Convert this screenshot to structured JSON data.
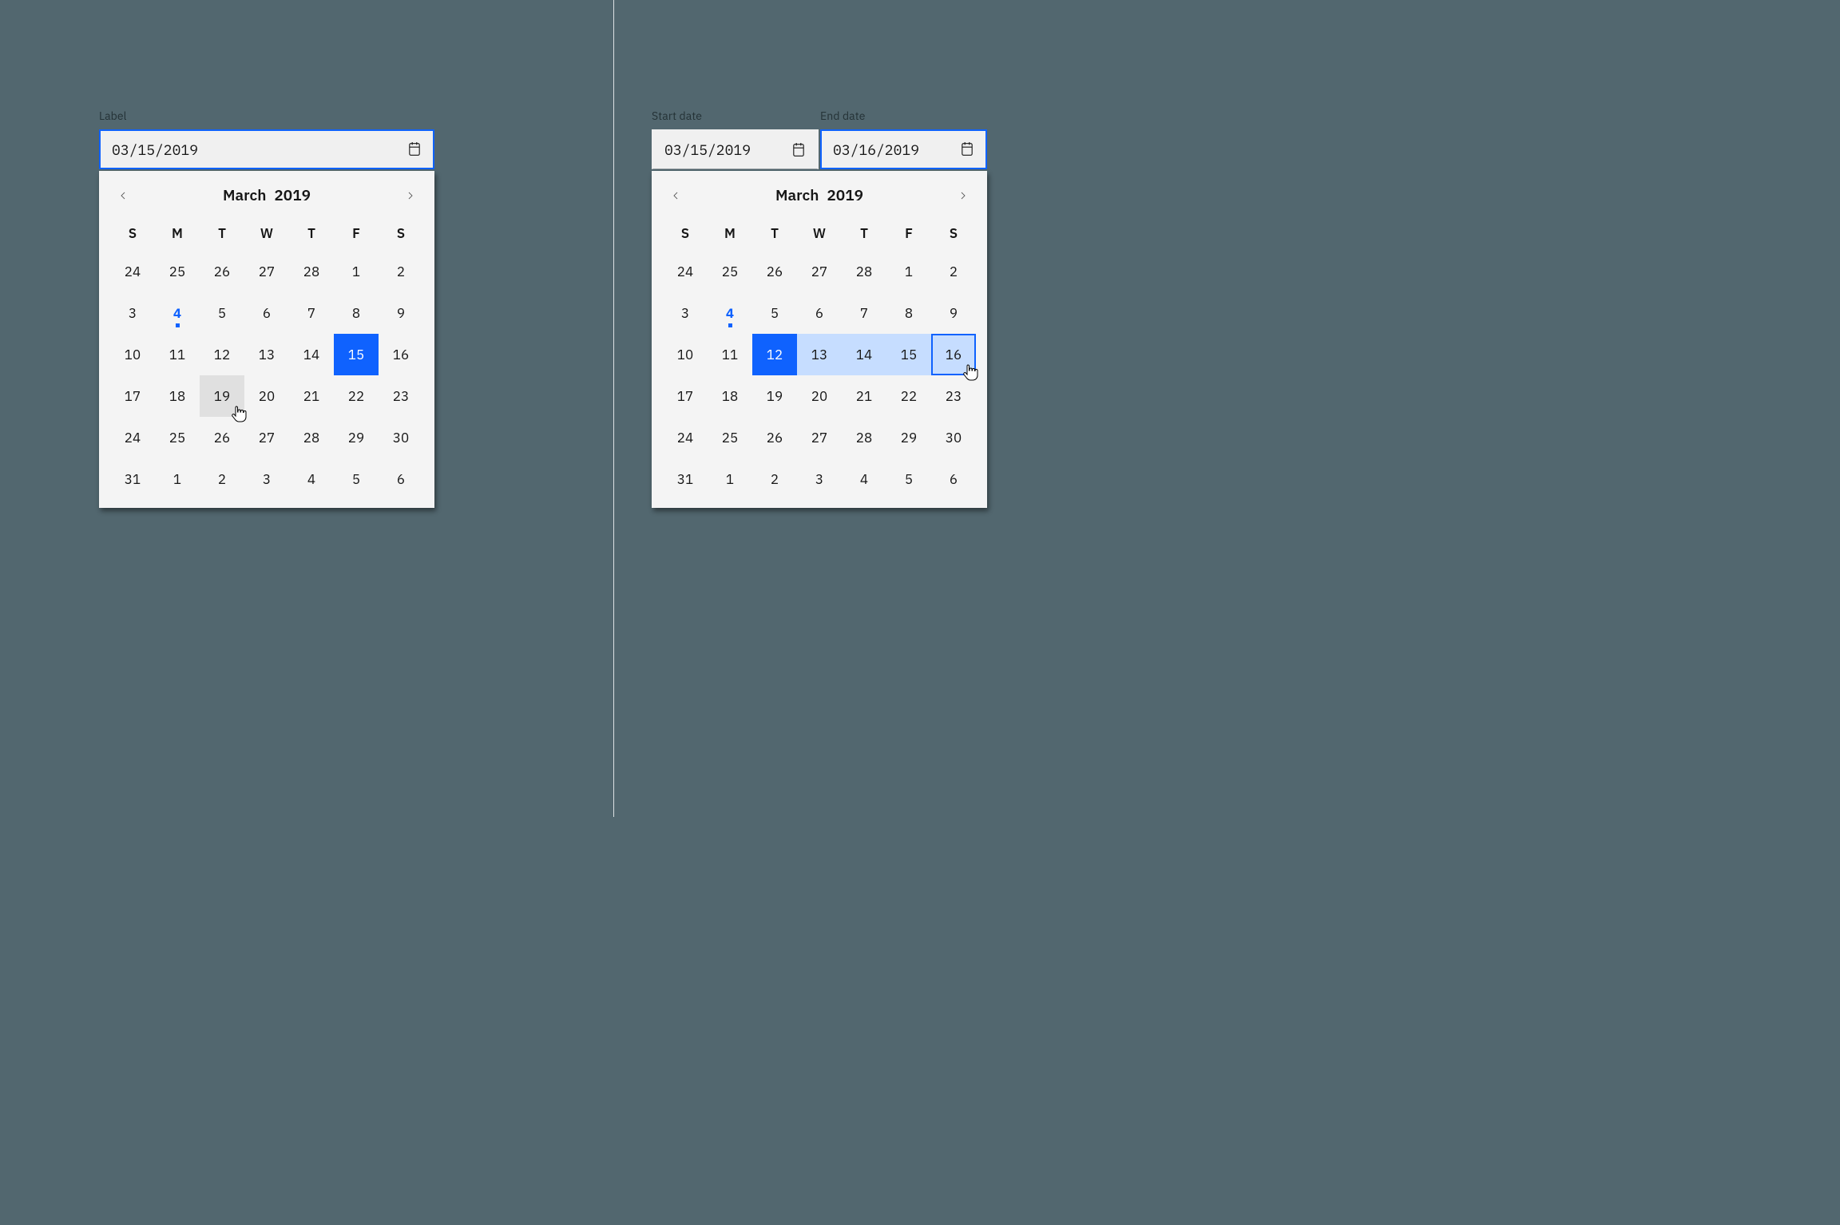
{
  "left": {
    "label": "Label",
    "value": "03/15/2019",
    "month": "March",
    "year": "2019",
    "dow": [
      "S",
      "M",
      "T",
      "W",
      "T",
      "F",
      "S"
    ],
    "days": [
      {
        "n": "24",
        "role": "prev"
      },
      {
        "n": "25",
        "role": "prev"
      },
      {
        "n": "26",
        "role": "prev"
      },
      {
        "n": "27",
        "role": "prev"
      },
      {
        "n": "28",
        "role": "prev"
      },
      {
        "n": "1"
      },
      {
        "n": "2"
      },
      {
        "n": "3"
      },
      {
        "n": "4",
        "today": true
      },
      {
        "n": "5"
      },
      {
        "n": "6"
      },
      {
        "n": "7"
      },
      {
        "n": "8"
      },
      {
        "n": "9"
      },
      {
        "n": "10"
      },
      {
        "n": "11"
      },
      {
        "n": "12"
      },
      {
        "n": "13"
      },
      {
        "n": "14"
      },
      {
        "n": "15",
        "selected": true
      },
      {
        "n": "16"
      },
      {
        "n": "17"
      },
      {
        "n": "18"
      },
      {
        "n": "19",
        "hover": true
      },
      {
        "n": "20"
      },
      {
        "n": "21"
      },
      {
        "n": "22"
      },
      {
        "n": "23"
      },
      {
        "n": "24"
      },
      {
        "n": "25"
      },
      {
        "n": "26"
      },
      {
        "n": "27"
      },
      {
        "n": "28"
      },
      {
        "n": "29"
      },
      {
        "n": "30"
      },
      {
        "n": "31"
      },
      {
        "n": "1",
        "role": "next"
      },
      {
        "n": "2",
        "role": "next"
      },
      {
        "n": "3",
        "role": "next"
      },
      {
        "n": "4",
        "role": "next"
      },
      {
        "n": "5",
        "role": "next"
      },
      {
        "n": "6",
        "role": "next"
      }
    ]
  },
  "right": {
    "start_label": "Start date",
    "start_value": "03/15/2019",
    "end_label": "End date",
    "end_value": "03/16/2019",
    "month": "March",
    "year": "2019",
    "dow": [
      "S",
      "M",
      "T",
      "W",
      "T",
      "F",
      "S"
    ],
    "days": [
      {
        "n": "24",
        "role": "prev"
      },
      {
        "n": "25",
        "role": "prev"
      },
      {
        "n": "26",
        "role": "prev"
      },
      {
        "n": "27",
        "role": "prev"
      },
      {
        "n": "28",
        "role": "prev"
      },
      {
        "n": "1"
      },
      {
        "n": "2"
      },
      {
        "n": "3"
      },
      {
        "n": "4",
        "today": true
      },
      {
        "n": "5"
      },
      {
        "n": "6"
      },
      {
        "n": "7"
      },
      {
        "n": "8"
      },
      {
        "n": "9"
      },
      {
        "n": "10"
      },
      {
        "n": "11"
      },
      {
        "n": "12",
        "rangeStart": true
      },
      {
        "n": "13",
        "inRange": true
      },
      {
        "n": "14",
        "inRange": true
      },
      {
        "n": "15",
        "inRange": true
      },
      {
        "n": "16",
        "rangeEnd": true
      },
      {
        "n": "17"
      },
      {
        "n": "18"
      },
      {
        "n": "19"
      },
      {
        "n": "20"
      },
      {
        "n": "21"
      },
      {
        "n": "22"
      },
      {
        "n": "23"
      },
      {
        "n": "24"
      },
      {
        "n": "25"
      },
      {
        "n": "26"
      },
      {
        "n": "27"
      },
      {
        "n": "28"
      },
      {
        "n": "29"
      },
      {
        "n": "30"
      },
      {
        "n": "31"
      },
      {
        "n": "1",
        "role": "next"
      },
      {
        "n": "2",
        "role": "next"
      },
      {
        "n": "3",
        "role": "next"
      },
      {
        "n": "4",
        "role": "next"
      },
      {
        "n": "5",
        "role": "next"
      },
      {
        "n": "6",
        "role": "next"
      }
    ]
  }
}
